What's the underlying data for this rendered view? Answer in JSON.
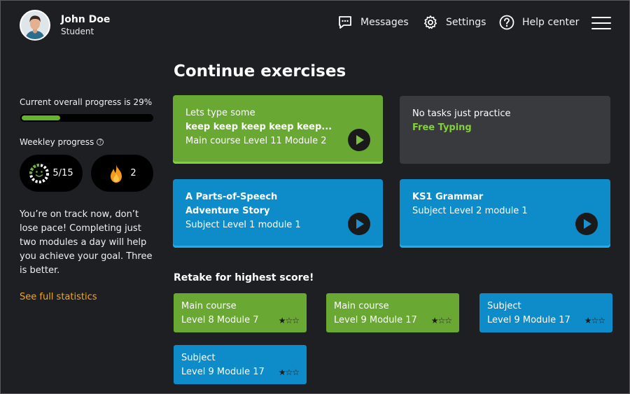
{
  "user": {
    "name": "John Doe",
    "role": "Student"
  },
  "nav": {
    "messages": "Messages",
    "settings": "Settings",
    "help": "Help center"
  },
  "sidebar": {
    "progress_text": "Current overall progress is 29%",
    "progress_fraction": 0.29,
    "weekly_label": "Weekley progress",
    "weekly_count": "5/15",
    "streak": "2",
    "message": "You’re on track now, don’t lose pace! Completing just two modules a day will help you achieve your goal. Three is better.",
    "stats_link": "See full statistics"
  },
  "main": {
    "title": "Continue exercises",
    "cards": [
      {
        "line1": "Lets type some",
        "line2": "keep keep keep keep keep...",
        "line3": "Main course Level 11 Module 2"
      },
      {
        "line1": "No tasks just practice",
        "line2": "Free Typing"
      },
      {
        "line1": "A Parts-of-Speech",
        "line2": "Adventure Story",
        "line3": "Subject Level 1 module 1"
      },
      {
        "line1": "KS1 Grammar",
        "line2": "Subject Level 2 module 1"
      }
    ],
    "retake_title": "Retake for highest score!",
    "retake": [
      {
        "title": "Main course",
        "sub": "Level 8 Module 7",
        "stars": "★☆☆"
      },
      {
        "title": "Main course",
        "sub": "Level 9 Module 17",
        "stars": "★☆☆"
      },
      {
        "title": "Subject",
        "sub": "Level 9 Module 17",
        "stars": "★☆☆"
      },
      {
        "title": "Subject",
        "sub": "Level 9 Module 17",
        "stars": "★☆☆"
      }
    ]
  },
  "colors": {
    "background": "#1e1f23",
    "green": "#69a832",
    "blue": "#0e8cc9",
    "accent_orange": "#f5a623",
    "progress": "#64b52b"
  },
  "icons": {
    "messages": "chat-bubble-icon",
    "settings": "gear-icon",
    "help": "question-circle-icon",
    "menu": "hamburger-icon",
    "streak": "flame-icon",
    "weekly": "smiley-progress-icon"
  }
}
